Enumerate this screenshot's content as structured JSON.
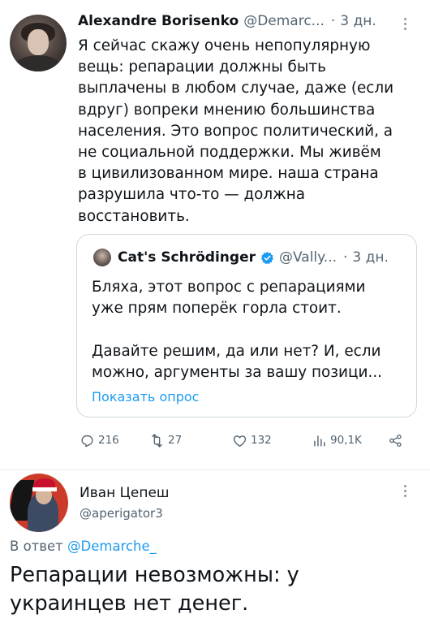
{
  "tweet1": {
    "author_name": "Alexandre Borisenko",
    "handle": "@Demarc...",
    "separator": "·",
    "time": "3 дн.",
    "text": "Я сейчас скажу очень непопулярную\nвещь: репарации должны быть\nвыплачены в любом случае, даже (если\nвдруг) вопреки мнению большинства\nнаселения. Это вопрос политический, а\nне социальной поддержки. Мы живём\nв цивилизованном мире. наша страна\nразрушила что-то — должна\nвосстановить.",
    "quote": {
      "author_name": "Cat's Schrödinger",
      "handle": "@Vally...",
      "separator": "·",
      "time": "3 дн.",
      "text": "Бляха, этот вопрос с репарациями\nуже прям поперёк горла стоит.\n\nДавайте решим, да или нет? И, если\nможно, аргументы за вашу позици...",
      "poll_link": "Показать опрос"
    },
    "actions": {
      "replies": "216",
      "retweets": "27",
      "likes": "132",
      "views": "90,1K"
    },
    "icons": [
      "more-icon",
      "verified-icon",
      "reply-icon",
      "retweet-icon",
      "like-icon",
      "views-icon",
      "share-icon"
    ]
  },
  "tweet2": {
    "author_name": "Иван Цепеш",
    "handle": "@aperigator3",
    "reply_prefix": "В ответ",
    "reply_mention": "@Demarche_",
    "text": "Репарации невозможны: у\nукраинцев нет денег."
  },
  "colors": {
    "text": "#0f1419",
    "secondary": "#536471",
    "link": "#1d9bf0",
    "border": "#cfd9de"
  }
}
